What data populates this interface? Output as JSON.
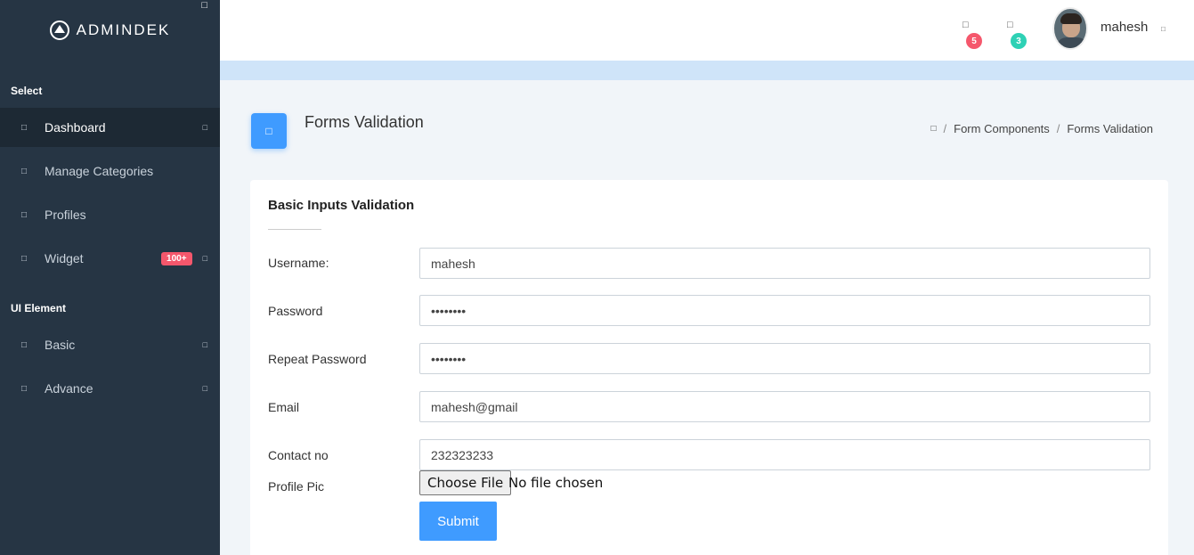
{
  "brand": {
    "name": "ADMINDEK",
    "toggle_icon": "□"
  },
  "sidebar": {
    "sections": [
      {
        "label": "Select"
      },
      {
        "label": "UI Element"
      }
    ],
    "items": [
      {
        "label": "Dashboard",
        "icon": "□",
        "arrow": "□",
        "active": true
      },
      {
        "label": "Manage Categories",
        "icon": "□"
      },
      {
        "label": "Profiles",
        "icon": "□"
      },
      {
        "label": "Widget",
        "icon": "□",
        "badge": "100+",
        "arrow": "□"
      },
      {
        "label": "Basic",
        "icon": "□",
        "arrow": "□"
      },
      {
        "label": "Advance",
        "icon": "□",
        "arrow": "□"
      }
    ]
  },
  "header": {
    "notifications": {
      "icon": "□",
      "count": "5",
      "color": "#f5576c"
    },
    "messages": {
      "icon": "□",
      "count": "3",
      "color": "#2ed1b5"
    },
    "user": {
      "name": "mahesh",
      "caret": "□"
    }
  },
  "page": {
    "title": "Forms Validation",
    "title_icon": "□",
    "breadcrumb": {
      "home_icon": "□",
      "items": [
        "Form Components",
        "Forms Validation"
      ]
    }
  },
  "form": {
    "title": "Basic Inputs Validation",
    "fields": [
      {
        "label": "Username:",
        "value": "mahesh"
      },
      {
        "label": "Password",
        "value": "••••••••"
      },
      {
        "label": "Repeat Password",
        "value": "••••••••"
      },
      {
        "label": "Email",
        "value": "mahesh@gmail"
      },
      {
        "label": "Contact no",
        "value": "232323233"
      }
    ],
    "file": {
      "label": "Profile Pic",
      "button": "Choose File",
      "status": "No file chosen"
    },
    "submit_label": "Submit"
  },
  "colors": {
    "accent": "#3f9bff",
    "sidebar": "#263544",
    "danger": "#f5576c",
    "success": "#2ed1b5"
  }
}
